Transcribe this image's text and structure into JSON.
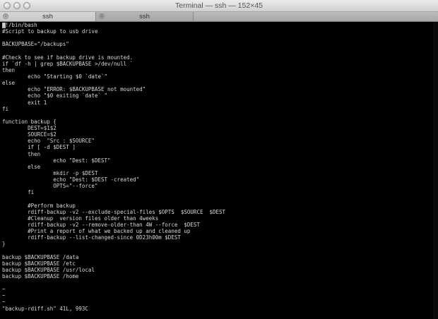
{
  "window": {
    "title": "Terminal — ssh — 152×45"
  },
  "tabs": [
    {
      "label": "ssh",
      "close_glyph": "⊗"
    },
    {
      "label": "ssh",
      "close_glyph": "⊗"
    }
  ],
  "terminal": {
    "lines": [
      "#!/bin/bash",
      "#Script to backup to usb drive",
      "",
      "BACKUPBASE=\"/backups\"",
      "",
      "#Check to see if backup drive is mounted.",
      "if `df -h | grep $BACKUPBASE >/dev/null `",
      "then",
      "        echo \"Starting $0 `date`\"",
      "else",
      "        echo \"ERROR: $BACKUPBASE not mounted\"",
      "        echo \"$0 exiting `date` \"",
      "        exit 1",
      "fi",
      "",
      "function backup {",
      "        DEST=$1$2",
      "        SOURCE=$2",
      "        echo  \"Src : $SOURCE\"",
      "        if [ -d $DEST ]",
      "        then",
      "                echo \"Dest: $DEST\"",
      "        else",
      "                mkdir -p $DEST",
      "                echo \"Dest: $DEST -created\"",
      "                OPTS=\"--force\"",
      "        fi",
      "",
      "        #Perform backup",
      "        rdiff-backup -v2 --exclude-special-files $OPTS  $SOURCE  $DEST",
      "        #Cleanup  version files older than 4weeks",
      "        rdiff-backup -v2 --remove-older-than 4W --force  $DEST",
      "        #Print a report of what we backed up and cleaned up",
      "        rdiff-backup --list-changed-since 0D23h00m $DEST",
      "}",
      "",
      "backup $BACKUPBASE /data",
      "backup $BACKUPBASE /etc",
      "backup $BACKUPBASE /usr/local",
      "backup $BACKUPBASE /home",
      "",
      "~",
      "~",
      "~",
      "\"backup-rdiff.sh\" 41L, 993C"
    ]
  },
  "colors": {
    "background": "#000000",
    "text": "#d8d8d8"
  }
}
